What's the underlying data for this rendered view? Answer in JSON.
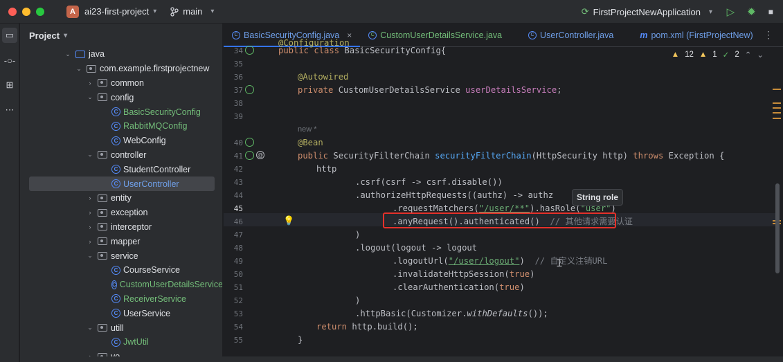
{
  "titlebar": {
    "project_initial": "A",
    "project_name": "ai23-first-project",
    "branch": "main",
    "run_config": "FirstProjectNewApplication",
    "colors": {
      "close": "#ff5f57",
      "minimize": "#febc2e",
      "maximize": "#28c840"
    },
    "icons": [
      "git-branch-icon",
      "run-icon",
      "debug-icon",
      "stop-icon"
    ]
  },
  "project_panel": {
    "title": "Project",
    "tree": [
      {
        "label": "java",
        "kind": "folder-blue"
      },
      {
        "label": "com.example.firstprojectnew",
        "kind": "package"
      },
      {
        "label": "common",
        "kind": "package"
      },
      {
        "label": "config",
        "kind": "package"
      },
      {
        "label": "BasicSecurityConfig",
        "kind": "class",
        "vcs": "added"
      },
      {
        "label": "RabbitMQConfig",
        "kind": "class",
        "vcs": "added"
      },
      {
        "label": "WebConfig",
        "kind": "class"
      },
      {
        "label": "controller",
        "kind": "package"
      },
      {
        "label": "StudentController",
        "kind": "class"
      },
      {
        "label": "UserController",
        "kind": "class",
        "selected": true
      },
      {
        "label": "entity",
        "kind": "package"
      },
      {
        "label": "exception",
        "kind": "package"
      },
      {
        "label": "interceptor",
        "kind": "package"
      },
      {
        "label": "mapper",
        "kind": "package"
      },
      {
        "label": "service",
        "kind": "package"
      },
      {
        "label": "CourseService",
        "kind": "class"
      },
      {
        "label": "CustomUserDetailsService",
        "kind": "class",
        "vcs": "added"
      },
      {
        "label": "ReceiverService",
        "kind": "class",
        "vcs": "added"
      },
      {
        "label": "UserService",
        "kind": "class"
      },
      {
        "label": "utill",
        "kind": "package"
      },
      {
        "label": "JwtUtil",
        "kind": "class",
        "vcs": "added"
      },
      {
        "label": "vo",
        "kind": "package"
      }
    ]
  },
  "tabs": [
    {
      "label": "BasicSecurityConfig.java",
      "active": true
    },
    {
      "label": "CustomUserDetailsService.java"
    },
    {
      "label": "UserController.java"
    },
    {
      "label": "pom.xml (FirstProjectNew)"
    }
  ],
  "inspections": {
    "warnings": "12",
    "weak_warnings": "1",
    "ok": "2"
  },
  "tooltip": "String role",
  "code": {
    "line_numbers": [
      "34",
      "35",
      "36",
      "37",
      "38",
      "39",
      "40",
      "41",
      "42",
      "43",
      "44",
      "45",
      "46",
      "47",
      "48",
      "49",
      "50",
      "51",
      "52",
      "53",
      "54",
      "55"
    ],
    "lines": {
      "l33": "@Configuration",
      "l34_kw": "public class ",
      "l34_name": "BasicSecurityConfig{",
      "l36": "@Autowired",
      "l37_kw": "private ",
      "l37_type": "CustomUserDetailsService ",
      "l37_field": "userDetailsService",
      "l37_end": ";",
      "hint_new": "new *",
      "l40": "@Bean",
      "l41_kw": "public ",
      "l41_type": "SecurityFilterChain ",
      "l41_fn": "securityFilterChain",
      "l41_params": "(HttpSecurity http) ",
      "l41_throws": "throws ",
      "l41_end": "Exception {",
      "l42": "http",
      "l43": ".csrf(csrf -> csrf.disable())",
      "l44": ".authorizeHttpRequests((authz) -> authz",
      "l45_a": ".requestMatchers(",
      "l45_str": "\"/user/**\"",
      "l45_b": ").hasRole(",
      "l45_str2": "\"user\"",
      "l45_c": ")",
      "l46_a": ".anyRequest().authenticated()  ",
      "l46_cmt": "// 其他请求需要认证",
      "l47": ")",
      "l48": ".logout(logout -> logout",
      "l49_a": ".logoutUrl(",
      "l49_str": "\"/user/logout\"",
      "l49_b": ")  ",
      "l49_cmt": "// 自定义注销URL",
      "l50_a": ".invalidateHttpSession(",
      "l50_kw": "true",
      "l50_b": ")",
      "l51_a": ".clearAuthentication(",
      "l51_kw": "true",
      "l51_b": ")",
      "l52": ")",
      "l53_a": ".httpBasic(Customizer.",
      "l53_it": "withDefaults",
      "l53_b": "());",
      "l54_kw": "return ",
      "l54_b": "http.build();",
      "l55": "}"
    }
  }
}
